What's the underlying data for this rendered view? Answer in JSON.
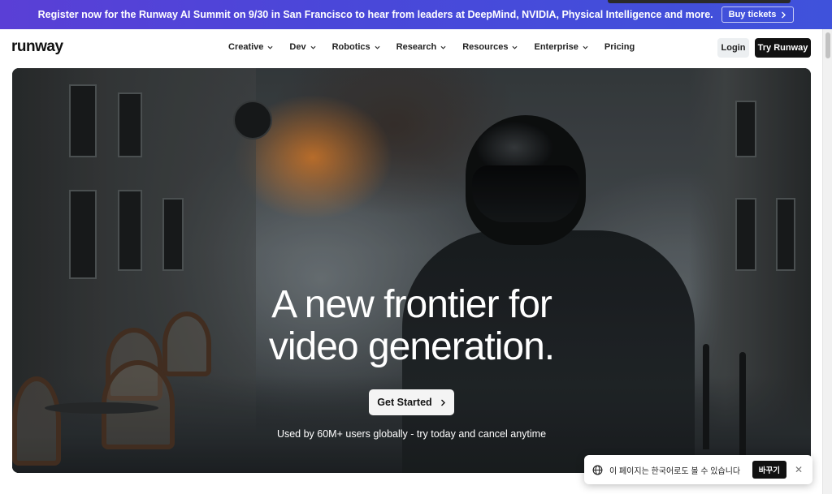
{
  "banner": {
    "text": "Register now for the Runway AI Summit on 9/30 in San Francisco to hear from leaders at DeepMind, NVIDIA, Physical Intelligence and more.",
    "button_label": "Buy tickets"
  },
  "nav": {
    "logo": "runway",
    "menu": [
      {
        "label": "Creative"
      },
      {
        "label": "Dev"
      },
      {
        "label": "Robotics"
      },
      {
        "label": "Research"
      },
      {
        "label": "Resources"
      },
      {
        "label": "Enterprise"
      },
      {
        "label": "Pricing"
      }
    ],
    "login_label": "Login",
    "cta_label": "Try Runway"
  },
  "hero": {
    "headline_line1": "A new frontier for",
    "headline_line2": "video generation.",
    "button_label": "Get Started",
    "subline": "Used by 60M+ users globally - try today and cancel anytime"
  },
  "translate_popup": {
    "text": "이 페이지는 한국어로도 볼 수 있습니다",
    "button_label": "바꾸기"
  },
  "colors": {
    "banner_start": "#5a3fd6",
    "banner_end": "#3f52db",
    "primary_button": "#111111"
  }
}
